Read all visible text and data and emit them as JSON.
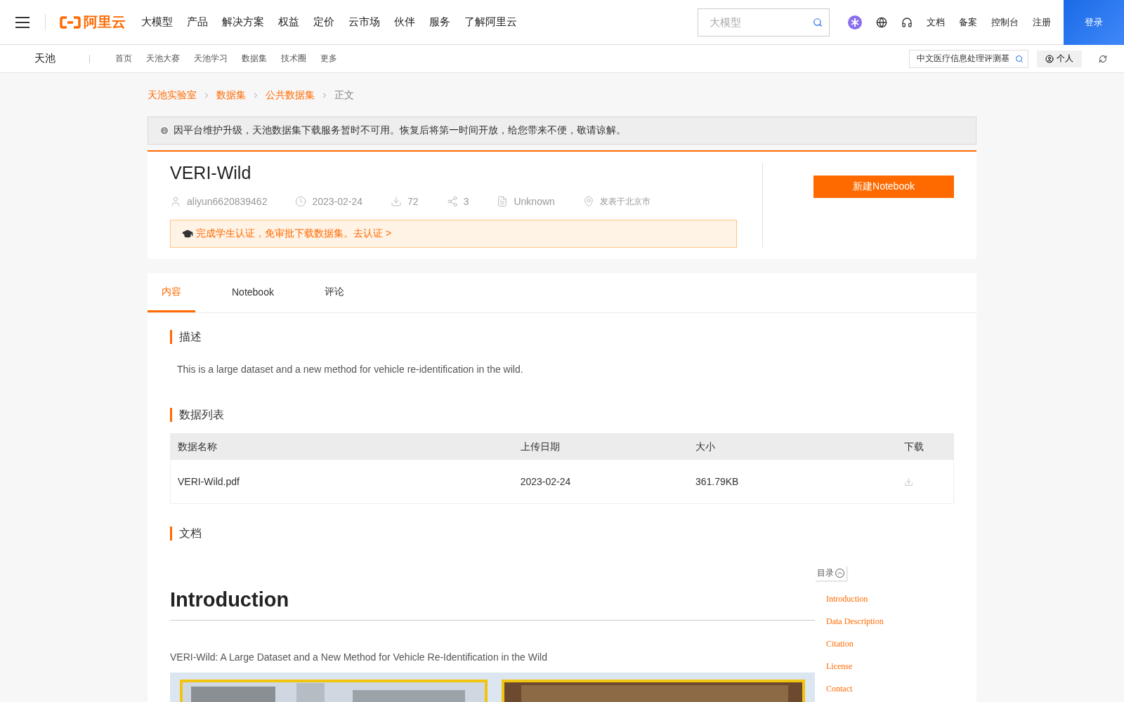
{
  "header": {
    "logo": "阿里云",
    "nav": [
      "大模型",
      "产品",
      "解决方案",
      "权益",
      "定价",
      "云市场",
      "伙伴",
      "服务",
      "了解阿里云"
    ],
    "search": {
      "placeholder": "大模型"
    },
    "links": [
      "文档",
      "备案",
      "控制台",
      "注册"
    ],
    "login": "登录"
  },
  "subnav": {
    "brand": "天池",
    "items": [
      "首页",
      "天池大赛",
      "天池学习",
      "数据集",
      "技术圈",
      "更多"
    ],
    "search": {
      "value": "中文医疗信息处理评测基"
    },
    "personal": "个人"
  },
  "breadcrumb": [
    {
      "label": "天池实验室",
      "link": true
    },
    {
      "label": "数据集",
      "link": true
    },
    {
      "label": "公共数据集",
      "link": true
    },
    {
      "label": "正文",
      "link": false
    }
  ],
  "notice": "因平台维护升级，天池数据集下载服务暂时不可用。恢复后将第一时间开放，给您带来不便，敬请谅解。",
  "dataset": {
    "title": "VERI-Wild",
    "meta": [
      {
        "kind": "user",
        "text": "aliyun6620839462"
      },
      {
        "kind": "date",
        "text": "2023-02-24"
      },
      {
        "kind": "downloads",
        "text": "72"
      },
      {
        "kind": "shares",
        "text": "3"
      },
      {
        "kind": "license",
        "text": "Unknown"
      },
      {
        "kind": "location",
        "text": "发表于北京市"
      }
    ],
    "promo": "完成学生认证，免审批下载数据集。去认证 >",
    "notebook_button": "新建Notebook"
  },
  "tabs": [
    {
      "label": "内容",
      "selected": true
    },
    {
      "label": "Notebook",
      "selected": false
    },
    {
      "label": "评论",
      "selected": false
    }
  ],
  "description": {
    "heading": "描述",
    "text": "This is a large dataset and a new method for vehicle re-identification in the wild."
  },
  "data_list": {
    "heading": "数据列表",
    "columns": [
      "数据名称",
      "上传日期",
      "大小",
      "下载"
    ],
    "rows": [
      {
        "name": "VERI-Wild.pdf",
        "date": "2023-02-24",
        "size": "361.79KB"
      }
    ]
  },
  "docs": {
    "heading": "文档",
    "toc_label": "目录",
    "toc": [
      "Introduction",
      "Data Description",
      "Citation",
      "License",
      "Contact"
    ],
    "doc_title": "Introduction",
    "doc_text": "VERI-Wild: A Large Dataset and a New Method for Vehicle Re-Identification in the Wild"
  }
}
